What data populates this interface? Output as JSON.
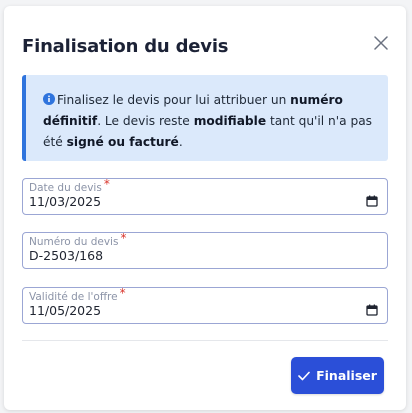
{
  "dialog": {
    "title": "Finalisation du devis",
    "close_icon": "close-icon"
  },
  "info": {
    "icon": "info-icon",
    "text_1": "Finalisez le devis pour lui attribuer un ",
    "bold_1": "numéro définitif",
    "text_2": ". Le devis reste ",
    "bold_2": "modifiable",
    "text_3": " tant qu'il n'a pas été ",
    "bold_3": "signé ou facturé",
    "text_4": "."
  },
  "fields": {
    "date": {
      "label": "Date du devis",
      "required_mark": "*",
      "value": "11/03/2025",
      "icon": "calendar-icon"
    },
    "numero": {
      "label": "Numéro du devis",
      "required_mark": "*",
      "value": "D-2503/168"
    },
    "validite": {
      "label": "Validité de l'offre",
      "required_mark": "*",
      "value": "11/05/2025",
      "icon": "calendar-icon"
    }
  },
  "actions": {
    "finalize_label": "Finaliser",
    "finalize_icon": "check-icon"
  },
  "colors": {
    "accent": "#2b4fd8",
    "info_bg": "#dbe9fb",
    "info_border": "#2f74dd",
    "required": "#d9342b"
  }
}
